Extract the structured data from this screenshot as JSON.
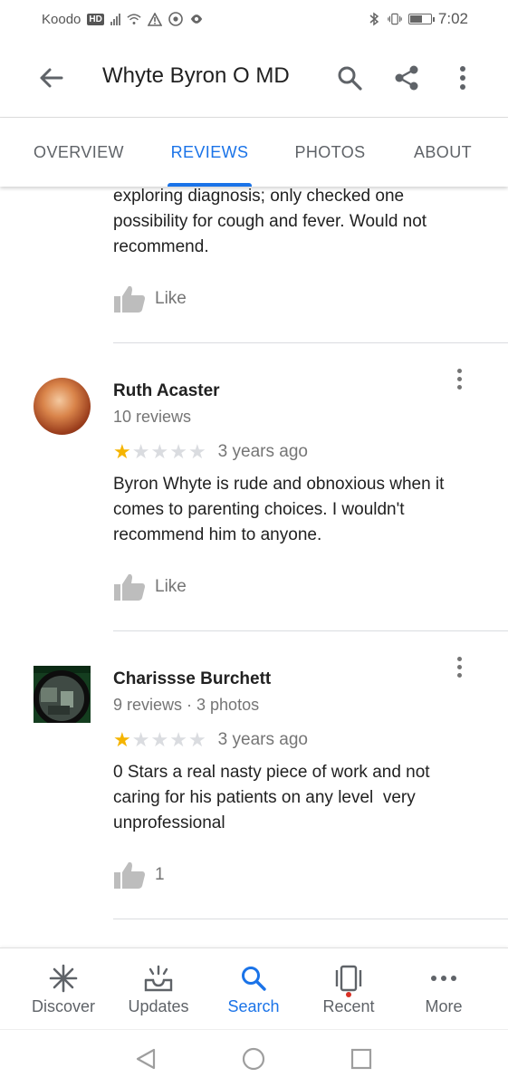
{
  "status_bar": {
    "carrier": "Koodo",
    "hd_badge": "HD",
    "time": "7:02",
    "battery_level": 0.6
  },
  "app_bar": {
    "title": "Whyte Byron O MD",
    "icons": [
      "back-arrow-icon",
      "search-icon",
      "share-icon",
      "more-vert-icon"
    ]
  },
  "tabs": [
    {
      "label": "OVERVIEW",
      "active": false
    },
    {
      "label": "REVIEWS",
      "active": true
    },
    {
      "label": "PHOTOS",
      "active": false
    },
    {
      "label": "ABOUT",
      "active": false
    }
  ],
  "partial_review": {
    "text_lines": [
      "exploring diagnosis; only checked one",
      "possibility for cough and fever. Would not",
      "recommend."
    ],
    "like_label": "Like"
  },
  "reviews": [
    {
      "name": "Ruth Acaster",
      "meta": "10 reviews",
      "rating": 1,
      "max_rating": 5,
      "time_ago": "3 years ago",
      "text_lines": [
        "Byron Whyte is rude and obnoxious when it",
        "comes to parenting choices. I wouldn't",
        "recommend him to anyone."
      ],
      "like_label": "Like"
    },
    {
      "name": "Charissse Burchett",
      "meta": "9 reviews · 3 photos",
      "rating": 1,
      "max_rating": 5,
      "time_ago": "3 years ago",
      "text_lines": [
        "0 Stars a real nasty piece of work and not",
        "caring for his patients on any level  very",
        "unprofessional"
      ],
      "like_label": "1"
    }
  ],
  "bottom_nav": [
    {
      "label": "Discover",
      "icon": "asterisk-icon",
      "active": false
    },
    {
      "label": "Updates",
      "icon": "updates-icon",
      "active": false
    },
    {
      "label": "Search",
      "icon": "search-icon",
      "active": true
    },
    {
      "label": "Recent",
      "icon": "recent-icon",
      "active": false
    },
    {
      "label": "More",
      "icon": "more-horiz-icon",
      "active": false
    }
  ],
  "colors": {
    "accent": "#1a73e8",
    "star": "#f5b400",
    "star_empty": "#dadce0",
    "text_secondary": "#757575"
  }
}
